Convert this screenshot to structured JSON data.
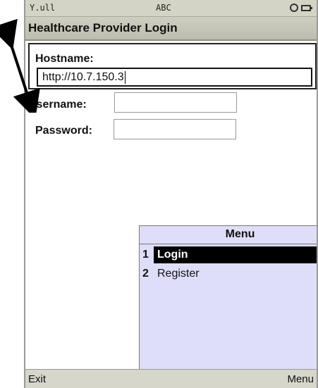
{
  "statusbar": {
    "signal": "Y.ull",
    "input_mode": "ABC"
  },
  "title": "Healthcare Provider Login",
  "form": {
    "hostname_label": "Hostname:",
    "hostname_value": "http://10.7.150.3",
    "username_label": "Username:",
    "username_value": "",
    "password_label": "Password:",
    "password_value": ""
  },
  "menu": {
    "title": "Menu",
    "items": [
      {
        "num": "1",
        "label": "Login",
        "selected": true
      },
      {
        "num": "2",
        "label": "Register",
        "selected": false
      }
    ]
  },
  "softkeys": {
    "left": "Exit",
    "right": "Menu"
  },
  "colors": {
    "menu_bg": "#dedef9",
    "selection": "#000000"
  },
  "icons": [
    "signal-strength-icon",
    "settings-icon",
    "battery-icon",
    "annotation-arrow-icon"
  ]
}
